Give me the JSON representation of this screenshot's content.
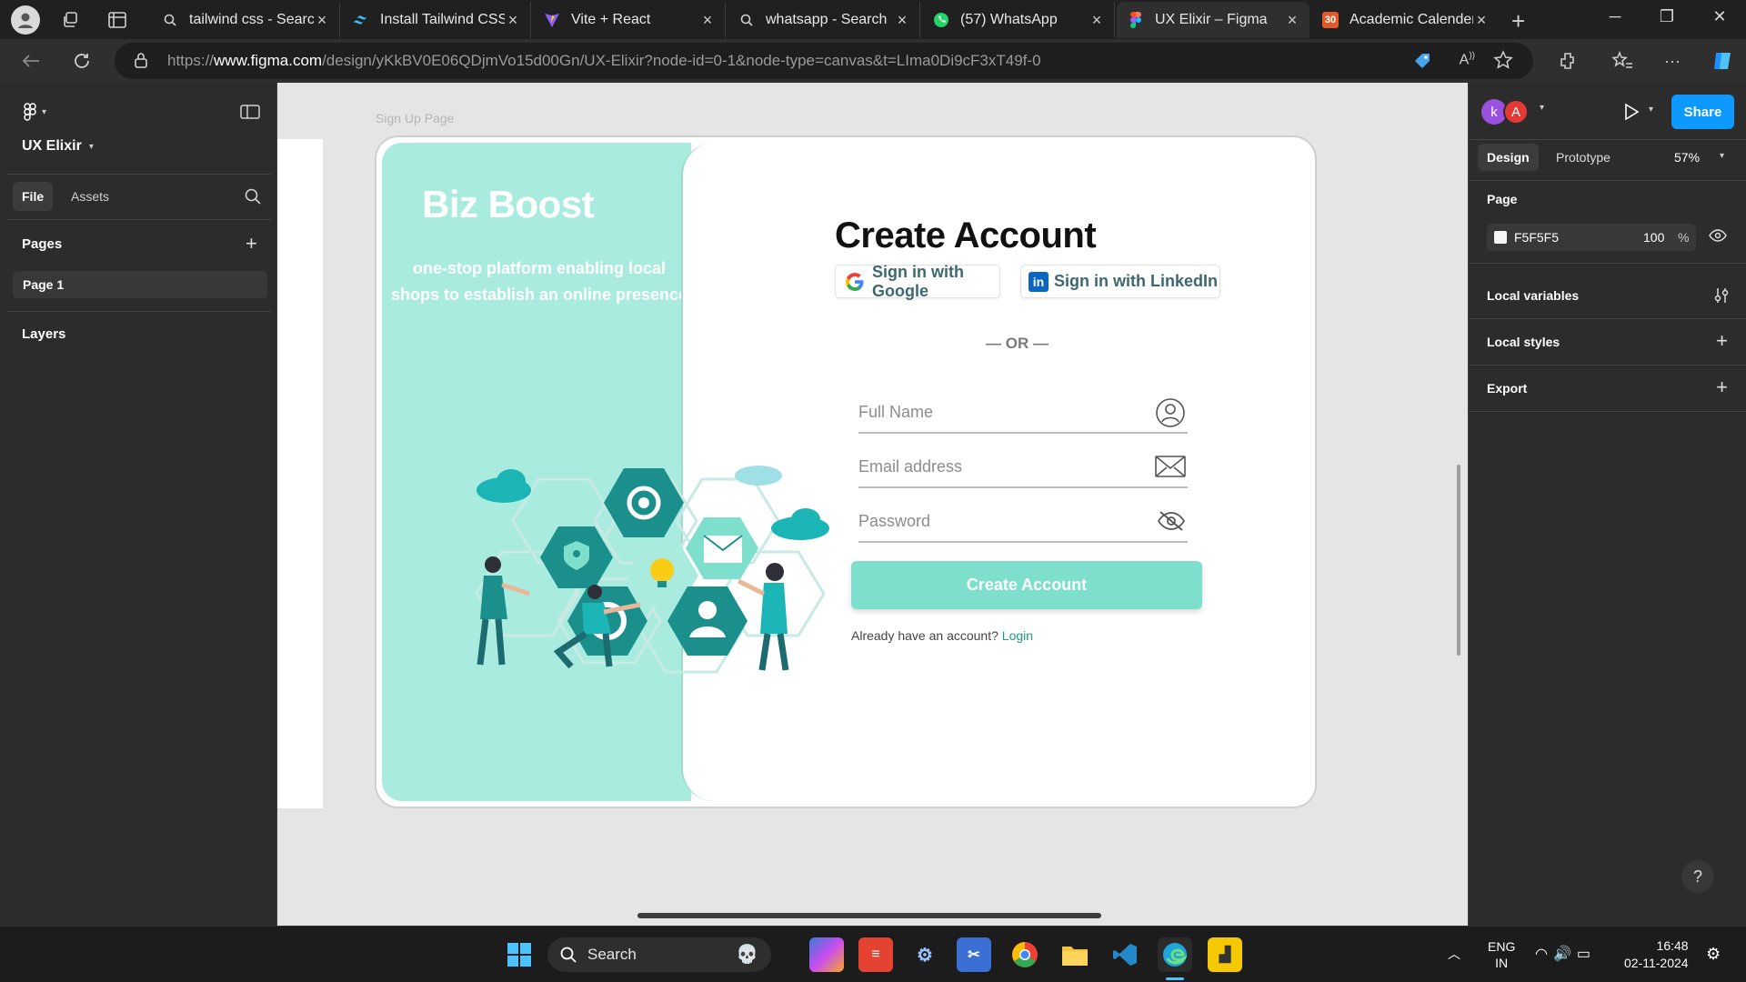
{
  "browser": {
    "tabs": [
      {
        "title": "tailwind css - Search",
        "icon": "search-icon"
      },
      {
        "title": "Install Tailwind CSS w",
        "icon": "tailwind-icon"
      },
      {
        "title": "Vite + React",
        "icon": "vite-icon"
      },
      {
        "title": "whatsapp - Search",
        "icon": "search-icon"
      },
      {
        "title": "(57) WhatsApp",
        "icon": "whatsapp-icon"
      },
      {
        "title": "UX Elixir – Figma",
        "icon": "figma-icon",
        "active": true
      },
      {
        "title": "Academic Calender",
        "icon": "calendar-icon"
      }
    ],
    "url_prefix": "https://",
    "url_domain": "www.figma.com",
    "url_path": "/design/yKkBV0E06QDjmVo15d00Gn/UX-Elixir?node-id=0-1&node-type=canvas&t=LIma0Di9cF3xT49f-0"
  },
  "figma": {
    "file_name": "UX Elixir",
    "left_panel": {
      "tabs": [
        "File",
        "Assets"
      ],
      "pages_heading": "Pages",
      "pages": [
        "Page 1"
      ],
      "layers_heading": "Layers"
    },
    "right_panel": {
      "avatars": [
        "k",
        "A"
      ],
      "share_label": "Share",
      "tabs": [
        "Design",
        "Prototype"
      ],
      "zoom": "57%",
      "page_heading": "Page",
      "page_color": "F5F5F5",
      "page_opacity": "100",
      "percent_sign": "%",
      "local_variables": "Local variables",
      "local_styles": "Local styles",
      "export": "Export",
      "help": "?"
    },
    "canvas": {
      "frame_label": "Sign Up Page",
      "brand": "Biz Boost",
      "tagline": "one-stop platform enabling local shops to establish an online presence",
      "title": "Create Account",
      "google_button": "Sign in with Google",
      "linkedin_button": "Sign in with LinkedIn",
      "or_text": "— OR —",
      "full_name_placeholder": "Full Name",
      "email_placeholder": "Email address",
      "password_placeholder": "Password",
      "submit_button": "Create Account",
      "login_prompt": "Already have an account?",
      "login_link": "Login"
    }
  },
  "taskbar": {
    "search_placeholder": "Search",
    "language": "ENG",
    "region": "IN",
    "time": "16:48",
    "date": "02-11-2024"
  },
  "colors": {
    "accent": "#0d99ff",
    "brand_mint": "#a9ecdf",
    "button_mint": "#7fdfcd",
    "teal_dark": "#1b8f8b",
    "login_link": "#1f9a85"
  }
}
